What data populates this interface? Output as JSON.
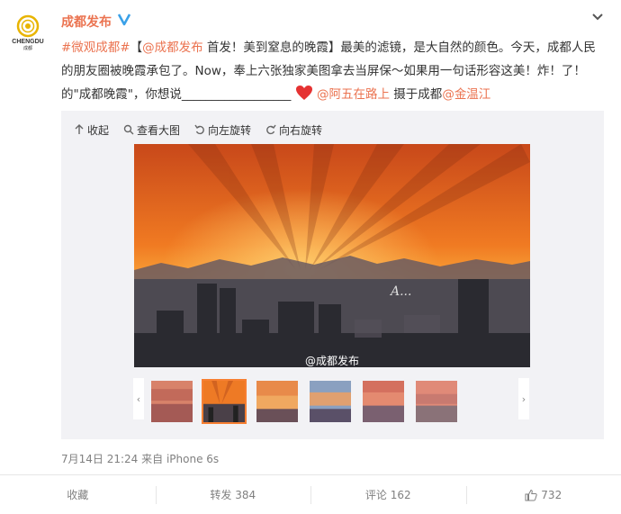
{
  "user": {
    "name": "成都发布",
    "avatar_text": "CHENGDU",
    "avatar_subtext": "成都"
  },
  "post": {
    "hashtag": "#微观成都#",
    "bracket_open": "【",
    "mention_source": "@成都发布",
    "headline": " 首发！美到窒息的晚霞】最美的滤镜，是大自然的颜色。今天，成都人民的朋友圈被晚霞承包了。Now，奉上六张独家美图拿去当屏保～如果用一句话形容这美！炸！了！的\"成都晚霞\"，你想说__________________",
    "mention_photographer": "@阿五在路上",
    "middle": " 摄于成都",
    "mention_editor": "@金温江"
  },
  "toolbar": {
    "collapse": "收起",
    "view_large": "查看大图",
    "rotate_left": "向左旋转",
    "rotate_right": "向右旋转"
  },
  "photo": {
    "watermark": "@成都发布",
    "signature": "A..."
  },
  "thumbnails": {
    "count": 6,
    "active_index": 1
  },
  "meta": {
    "timestamp": "7月14日 21:24",
    "source": "来自 iPhone 6s"
  },
  "actions": {
    "favorite": "收藏",
    "repost": "转发 384",
    "comment": "评论 162",
    "like": "732"
  },
  "colors": {
    "accent": "#eb7350",
    "verified": "#3aa1e8",
    "thumb_active": "#f77f32"
  }
}
